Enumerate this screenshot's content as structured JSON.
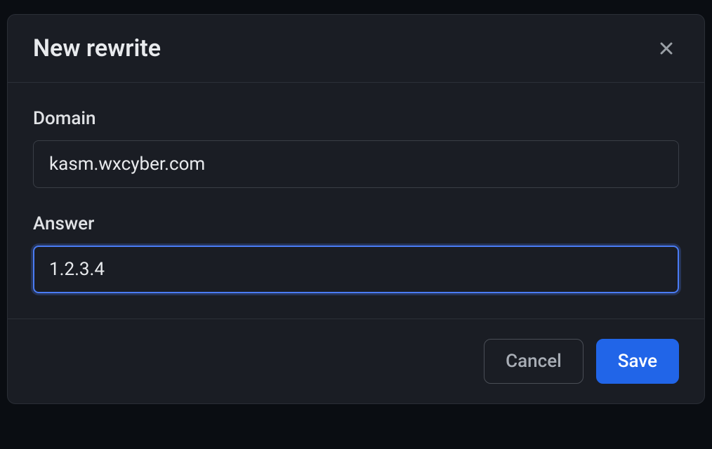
{
  "modal": {
    "title": "New rewrite",
    "fields": {
      "domain": {
        "label": "Domain",
        "value": "kasm.wxcyber.com"
      },
      "answer": {
        "label": "Answer",
        "value": "1.2.3.4"
      }
    },
    "buttons": {
      "cancel": "Cancel",
      "save": "Save"
    }
  }
}
